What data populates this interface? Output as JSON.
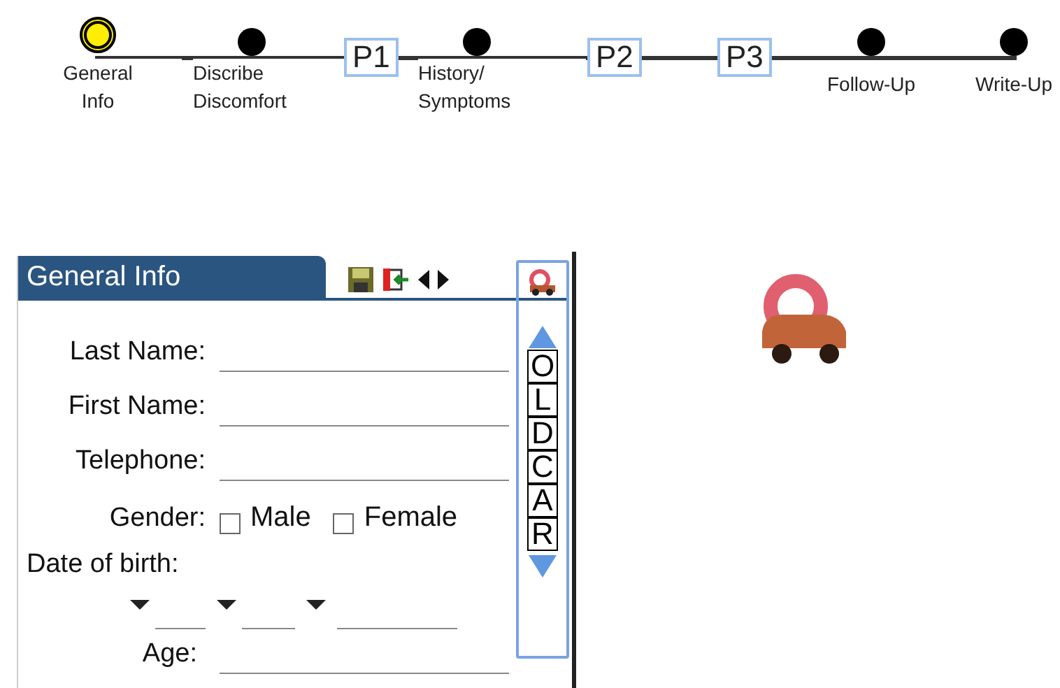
{
  "steps": [
    {
      "kind": "stop",
      "label": "General\nInfo",
      "selected": true
    },
    {
      "kind": "stop",
      "label": "Discribe\nDiscomfort",
      "selected": false
    },
    {
      "kind": "page",
      "label": "P1",
      "selected": false
    },
    {
      "kind": "stop",
      "label": "History/\nSymptoms",
      "selected": false
    },
    {
      "kind": "page",
      "label": "P2",
      "selected": false
    },
    {
      "kind": "page",
      "label": "P3",
      "selected": false
    },
    {
      "kind": "stop",
      "label": "Follow-Up",
      "selected": false
    },
    {
      "kind": "stop",
      "label": "Write-Up",
      "selected": false
    }
  ],
  "panel": {
    "title": "General Info",
    "fields": [
      {
        "kind": "text",
        "label": "Last Name:"
      },
      {
        "kind": "text",
        "label": "First Name:"
      },
      {
        "kind": "text",
        "label": "Telephone:"
      },
      {
        "kind": "choice",
        "label": "Gender:",
        "options": [
          {
            "label": "Male",
            "checked": false
          },
          {
            "label": "Female",
            "checked": false
          }
        ]
      },
      {
        "kind": "date",
        "label": "Date of birth:"
      },
      {
        "kind": "text",
        "label": "Age:"
      }
    ]
  },
  "letters": [
    "O",
    "L",
    "D",
    "C",
    "A",
    "R"
  ]
}
